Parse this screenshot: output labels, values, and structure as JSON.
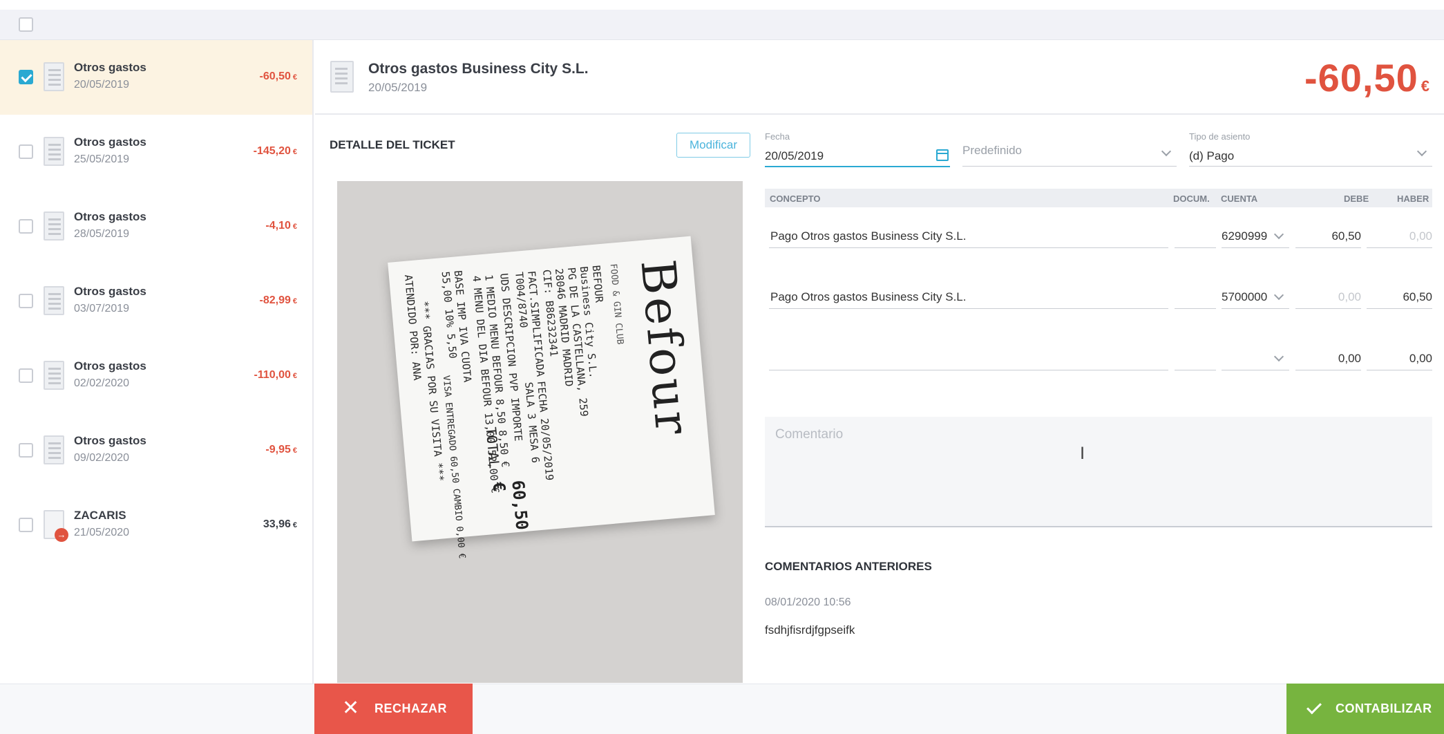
{
  "list": {
    "items": [
      {
        "name": "Otros gastos",
        "date": "20/05/2019",
        "amount": "-60,50",
        "currency": "€",
        "selected": true,
        "checked": true,
        "icon": "receipt-icon"
      },
      {
        "name": "Otros gastos",
        "date": "25/05/2019",
        "amount": "-145,20",
        "currency": "€",
        "checked": false,
        "icon": "receipt-icon"
      },
      {
        "name": "Otros gastos",
        "date": "28/05/2019",
        "amount": "-4,10",
        "currency": "€",
        "checked": false,
        "icon": "receipt-icon"
      },
      {
        "name": "Otros gastos",
        "date": "03/07/2019",
        "amount": "-82,99",
        "currency": "€",
        "checked": false,
        "icon": "receipt-icon"
      },
      {
        "name": "Otros gastos",
        "date": "02/02/2020",
        "amount": "-110,00",
        "currency": "€",
        "checked": false,
        "icon": "receipt-icon"
      },
      {
        "name": "Otros gastos",
        "date": "09/02/2020",
        "amount": "-9,95",
        "currency": "€",
        "checked": false,
        "icon": "receipt-icon"
      },
      {
        "name": "ZACARIS",
        "date": "21/05/2020",
        "amount": "33,96",
        "currency": "€",
        "checked": false,
        "icon": "income-document-icon"
      }
    ]
  },
  "detail": {
    "title": "Otros gastos Business City S.L.",
    "date": "20/05/2019",
    "total": "-60,50",
    "currency": "€"
  },
  "ticket": {
    "section_title": "DETALLE DEL TICKET",
    "modify_label": "Modificar",
    "receipt": {
      "brand": "Befour",
      "tagline": "FOOD & GIN CLUB",
      "company": "BEFOUR",
      "lines": [
        "Business City S.L.",
        "PG DE LA CASTELLANA, 259",
        "28046 MADRID MADRID",
        "CIF: B86232341",
        "FACT.SIMPLIFICADA",
        "T004/8740",
        "FECHA 20/05/2019",
        "SALA 3 MESA 6",
        "UDS DESCRIPCION PVP IMPORTE",
        "1 MEDIO MENU BEFOUR 8,50 8,50 €",
        "4 MENU DEL DIA BEFOUR 13,00 52,00 €",
        "BASE IMP IVA CUOTA",
        "55,00 10% 5,50",
        "TOTAL",
        "VISA ENTREGADO 60,50 CAMBIO 0,00 €",
        "*** GRACIAS POR SU VISITA ***",
        "ATENDIDO POR: ANA"
      ],
      "total": "60,50 €"
    }
  },
  "form": {
    "fecha_label": "Fecha",
    "fecha_value": "20/05/2019",
    "predefinido_placeholder": "Predefinido",
    "tipo_label": "Tipo de asiento",
    "tipo_value": "(d) Pago",
    "columns": [
      "CONCEPTO",
      "DOCUM.",
      "CUENTA",
      "DEBE",
      "HABER"
    ],
    "rows": [
      {
        "concepto": "Pago Otros gastos Business City S.L.",
        "docum": "",
        "cuenta": "6290999",
        "debe": "60,50",
        "haber": "0,00"
      },
      {
        "concepto": "Pago Otros gastos Business City S.L.",
        "docum": "",
        "cuenta": "5700000",
        "debe": "0,00",
        "haber": "60,50"
      },
      {
        "concepto": "",
        "docum": "",
        "cuenta": "",
        "debe": "0,00",
        "haber": "0,00"
      }
    ],
    "comment_placeholder": "Comentario"
  },
  "previous_comments": {
    "title": "COMENTARIOS ANTERIORES",
    "date": "08/01/2020 10:56",
    "text": "fsdhjfisrdjfgpseifk"
  },
  "actions": {
    "reject_label": "RECHAZAR",
    "post_label": "CONTABILIZAR"
  },
  "colors": {
    "accent": "#2aa9d2",
    "negative": "#e0533f",
    "reject": "#e8564a",
    "post": "#77b43f",
    "selected_row": "#fcf3e2"
  }
}
